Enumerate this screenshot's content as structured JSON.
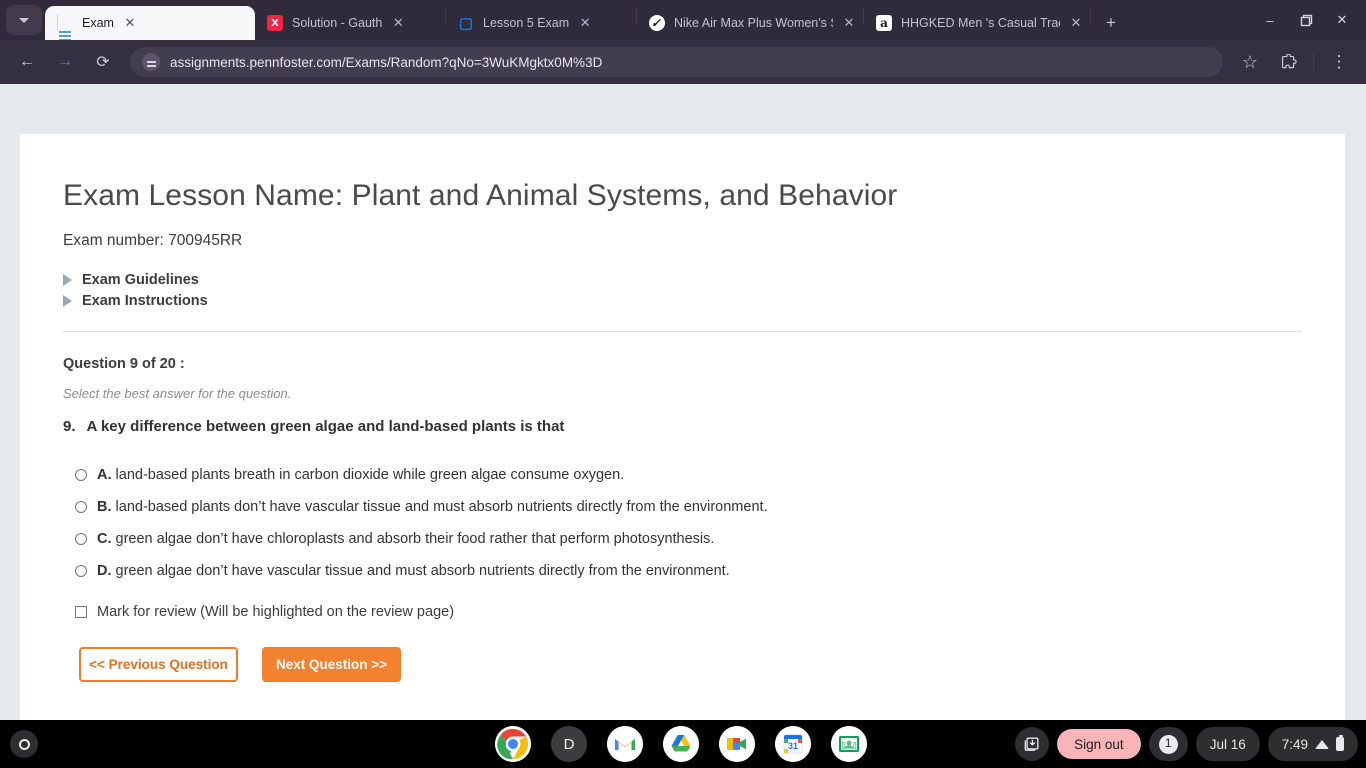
{
  "browser": {
    "tab_search_icon": "chevron-down-icon",
    "tabs": [
      {
        "title": "Exam",
        "favicon": "document-favicon",
        "active": true
      },
      {
        "title": "Solution - Gauth",
        "favicon": "gauth-favicon",
        "active": false
      },
      {
        "title": "Lesson 5 Exam",
        "favicon": "lesson-favicon",
        "active": false
      },
      {
        "title": "Nike Air Max Plus Women's S",
        "favicon": "nike-favicon",
        "active": false
      },
      {
        "title": "HHGKED Men 's Casual Track",
        "favicon": "amazon-favicon",
        "active": false
      }
    ],
    "new_tab_label": "+",
    "window_controls": {
      "minimize": "–",
      "maximize": "❐",
      "close": "✕"
    },
    "toolbar": {
      "back_icon": "←",
      "forward_icon": "→",
      "reload_icon": "⟳",
      "site_info_icon": "tune-icon",
      "url": "assignments.pennfoster.com/Exams/Random?qNo=3WuKMgktx0M%3D",
      "bookmark_icon": "☆",
      "extensions_icon": "puzzle-icon",
      "menu_icon": "⋮"
    }
  },
  "page": {
    "title": "Exam Lesson Name: Plant and Animal Systems, and Behavior",
    "exam_number": "Exam number: 700945RR",
    "disclosures": [
      {
        "label": "Exam Guidelines"
      },
      {
        "label": "Exam Instructions"
      }
    ],
    "question_counter": "Question 9 of 20 :",
    "instruction": "Select the best answer for the question.",
    "question_number": "9.",
    "question_text": "A key difference between green algae and land-based plants is that",
    "options": [
      {
        "letter": "A.",
        "text": "land-based plants breath in carbon dioxide while green algae consume oxygen.",
        "selected": false
      },
      {
        "letter": "B.",
        "text": "land-based plants don’t have vascular tissue and must absorb nutrients directly from the environment.",
        "selected": false
      },
      {
        "letter": "C.",
        "text": "green algae don’t have chloroplasts and absorb their food rather that perform photosynthesis.",
        "selected": false
      },
      {
        "letter": "D.",
        "text": "green algae don’t have vascular tissue and must absorb nutrients directly from the environment.",
        "selected": false
      }
    ],
    "mark_for_review": {
      "label": "Mark for review (Will be highlighted on the review page)",
      "checked": false
    },
    "buttons": {
      "previous": "<< Previous Question",
      "next": "Next Question >>"
    },
    "colors": {
      "accent_orange": "#f28130",
      "page_background": "#e4e9ec",
      "card_background": "#ffffff"
    }
  },
  "shelf": {
    "launcher_icon": "launcher-circle-icon",
    "apps": [
      {
        "name": "chrome",
        "label": "",
        "running": true
      },
      {
        "name": "docs-shortcut",
        "label": "D",
        "running": false
      },
      {
        "name": "gmail",
        "label": "",
        "running": false
      },
      {
        "name": "google-drive",
        "label": "",
        "running": false
      },
      {
        "name": "google-meet",
        "label": "",
        "running": false
      },
      {
        "name": "google-calendar",
        "label": "31",
        "running": false
      },
      {
        "name": "google-classroom",
        "label": "",
        "running": false
      }
    ],
    "status": {
      "downloads_icon": "downloads-tray-icon",
      "sign_out": "Sign out",
      "notification_count": "1",
      "date": "Jul 16",
      "time": "7:49",
      "wifi_icon": "wifi-icon",
      "battery_icon": "battery-icon"
    }
  }
}
